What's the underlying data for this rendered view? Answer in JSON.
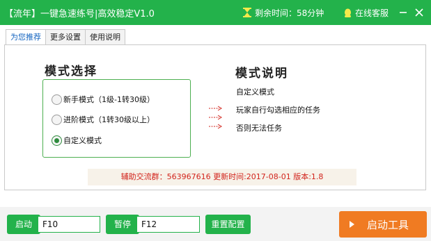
{
  "title_bar": {
    "title": "【流年】一键急速练号|高效稳定V1.0",
    "timer_text": "剩余时间：58分钟",
    "service_text": "在线客服"
  },
  "tabs": [
    {
      "label": "为您推荐",
      "active": true
    },
    {
      "label": "更多设置",
      "active": false
    },
    {
      "label": "使用说明",
      "active": false
    }
  ],
  "mode_select": {
    "heading": "模式选择",
    "options": [
      {
        "label": "新手模式（1级-1转30级）",
        "checked": false
      },
      {
        "label": "进阶模式（1转30级以上）",
        "checked": false
      },
      {
        "label": "自定义模式",
        "checked": true
      }
    ]
  },
  "mode_desc": {
    "heading": "模式说明",
    "lines": [
      "自定义模式",
      "玩家自行勾选相应的任务",
      "否则无法任务"
    ]
  },
  "info_text": "辅助交流群：563967616  更新时间:2017-08-01  版本:1.8",
  "footer": {
    "start_label": "启动",
    "start_hotkey": "F10",
    "pause_label": "暂停",
    "pause_hotkey": "F12",
    "reset_label": "重置配置",
    "launch_label": "启动工具"
  },
  "colors": {
    "brand_green": "#23b24b",
    "launch_orange": "#f07b22",
    "info_red": "#d2241c",
    "active_tab_blue": "#1565c0"
  }
}
